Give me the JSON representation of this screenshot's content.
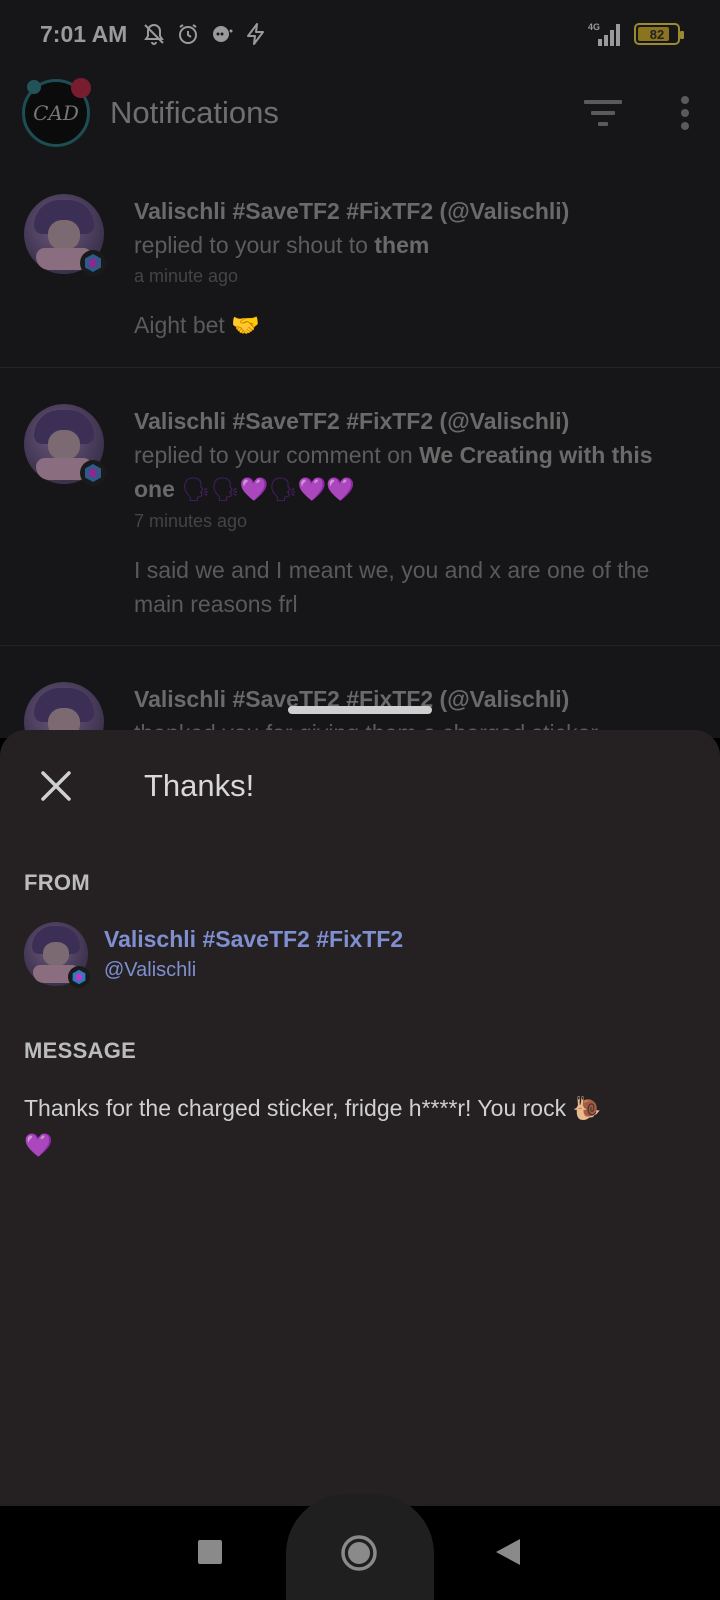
{
  "status_bar": {
    "time": "7:01 AM",
    "icons": [
      "mute-bell-icon",
      "alarm-icon",
      "chat-bubble-icon",
      "flash-icon"
    ],
    "network": "4G",
    "battery": "82",
    "battery_level": 0.82
  },
  "header": {
    "logo_text": "CAD",
    "title": "Notifications",
    "icons": [
      "filter-icon",
      "more-vert-icon"
    ]
  },
  "notifications": [
    {
      "author": "Valischli #SaveTF2 #FixTF2 (@Valischli)",
      "action_prefix": "replied to your shout to ",
      "action_bold": "them",
      "time": "a minute ago",
      "message_text": "Aight bet ",
      "message_emoji": "🤝"
    },
    {
      "author": "Valischli #SaveTF2 #FixTF2 (@Valischli)",
      "action_prefix": "replied to your comment on ",
      "action_bold": "We Creating with this one",
      "action_emojis": "🗣🗣💜🗣💜💜",
      "time": "7 minutes ago",
      "message_text": "I said we and I meant we, you and x are one of the main reasons frl"
    },
    {
      "author": "Valischli #SaveTF2 #FixTF2 (@Valischli)",
      "action_prefix": "thanked you for giving them a charged sticker",
      "action_bold": ""
    }
  ],
  "sheet": {
    "title": "Thanks!",
    "from_label": "FROM",
    "sender_name": "Valischli #SaveTF2 #FixTF2",
    "sender_handle": "@Valischli",
    "message_label": "MESSAGE",
    "message_text": "Thanks for the charged sticker, fridge h****r! You rock ",
    "message_emoji_1": "🐌",
    "message_emoji_2": "💜"
  },
  "nav_bar": {
    "icons": [
      "recents-square-icon",
      "home-circle-icon",
      "back-triangle-icon"
    ]
  }
}
